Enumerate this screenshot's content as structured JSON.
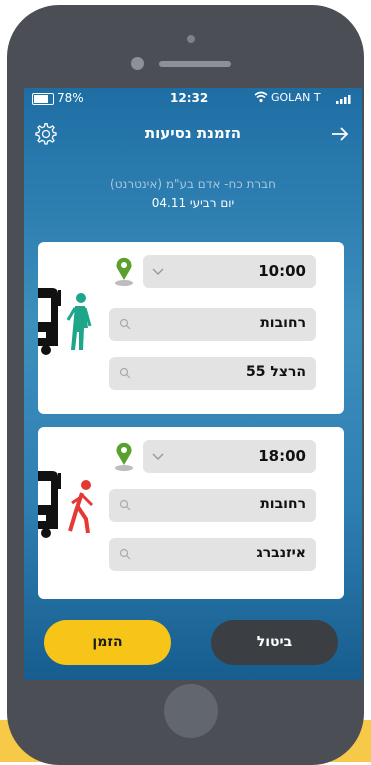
{
  "status": {
    "battery": "78%",
    "time": "12:32",
    "carrier": "GOLAN T"
  },
  "header": {
    "title": "הזמנת נסיעות"
  },
  "info": {
    "company": "חברת כח- אדם בע\"מ (אינטרנט)",
    "date": "יום רביעי 04.11"
  },
  "pickup": {
    "time": "10:00",
    "city": "רחובות",
    "street": "הרצל 55",
    "pin_color": "#5aa02c",
    "person_color": "#1fa58a"
  },
  "dropoff": {
    "time": "18:00",
    "city": "רחובות",
    "street": "איזנברג",
    "pin_color": "#5aa02c",
    "person_color": "#e53935"
  },
  "actions": {
    "confirm_label": "הזמן",
    "cancel_label": "ביטול"
  },
  "icons": {
    "settings": "gear-icon",
    "back": "arrow-right-icon",
    "search": "magnifier-icon",
    "pin": "location-pin-icon",
    "dropdown": "chevron-down-icon",
    "bus": "bus-icon",
    "boarding": "person-boarding-icon",
    "alighting": "person-walking-icon"
  },
  "colors": {
    "accent": "#f7c518",
    "dark_button": "#3b3f44"
  }
}
